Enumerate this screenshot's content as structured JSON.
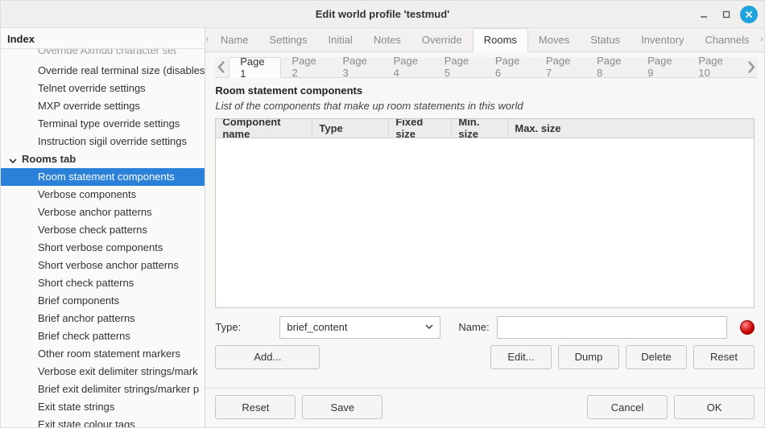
{
  "window": {
    "title": "Edit world profile 'testmud'"
  },
  "sidebar": {
    "header": "Index",
    "cut_item": "Override Axmud character set",
    "items_top": [
      "Override real terminal size (disables",
      "Telnet override settings",
      "MXP override settings",
      "Terminal type override settings",
      "Instruction sigil override settings"
    ],
    "group": "Rooms tab",
    "items_bottom": [
      "Room statement components",
      "Verbose components",
      "Verbose anchor patterns",
      "Verbose check patterns",
      "Short verbose components",
      "Short verbose anchor patterns",
      "Short check patterns",
      "Brief components",
      "Brief anchor patterns",
      "Brief check patterns",
      "Other room statement markers",
      "Verbose exit delimiter strings/mark",
      "Brief exit delimiter strings/marker p",
      "Exit state strings",
      "Exit state colour tags"
    ],
    "selected_index": 0
  },
  "topTabs": {
    "items": [
      "Name",
      "Settings",
      "Initial",
      "Notes",
      "Override",
      "Rooms",
      "Moves",
      "Status",
      "Inventory",
      "Channels"
    ],
    "active_index": 5
  },
  "subTabs": {
    "items": [
      "Page 1",
      "Page 2",
      "Page 3",
      "Page 4",
      "Page 5",
      "Page 6",
      "Page 7",
      "Page 8",
      "Page 9",
      "Page 10"
    ],
    "active_index": 0
  },
  "page": {
    "heading": "Room statement components",
    "sub": "List of the components that make up room statements in this world",
    "columns": {
      "c1": "Component name",
      "c2": "Type",
      "c3": "Fixed size",
      "c4": "Min. size",
      "c5": "Max. size"
    },
    "type_label": "Type:",
    "type_value": "brief_content",
    "name_label": "Name:",
    "name_value": "",
    "buttons": {
      "add": "Add...",
      "edit": "Edit...",
      "dump": "Dump",
      "delete": "Delete",
      "reset": "Reset"
    }
  },
  "footer": {
    "reset": "Reset",
    "save": "Save",
    "cancel": "Cancel",
    "ok": "OK"
  }
}
